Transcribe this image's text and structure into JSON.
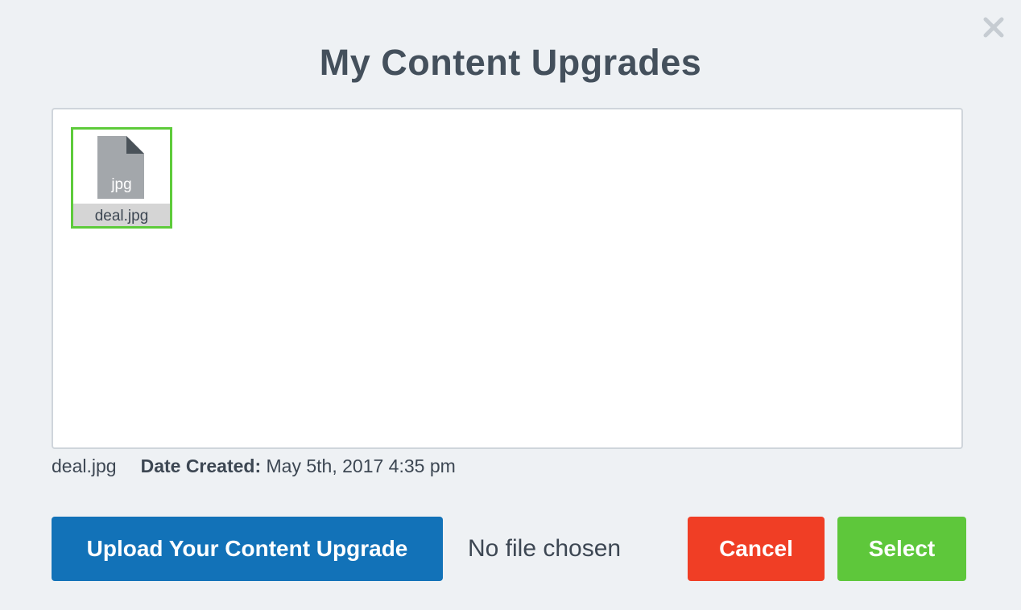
{
  "dialog": {
    "title": "My Content Upgrades",
    "close_icon": "close-icon"
  },
  "files": [
    {
      "name": "deal.jpg",
      "extension": "jpg",
      "icon": "file-icon",
      "selected": true
    }
  ],
  "selected_file": {
    "name": "deal.jpg",
    "date_label": "Date Created:",
    "date_value": "May 5th, 2017 4:35 pm"
  },
  "footer": {
    "upload_label": "Upload Your Content Upgrade",
    "no_file_text": "No file chosen",
    "cancel_label": "Cancel",
    "select_label": "Select"
  },
  "colors": {
    "background": "#eef1f4",
    "upload_button": "#1272b8",
    "cancel_button": "#f03e25",
    "select_button": "#5ec73b",
    "selected_border": "#5ecb3b",
    "title_text": "#44505c"
  }
}
